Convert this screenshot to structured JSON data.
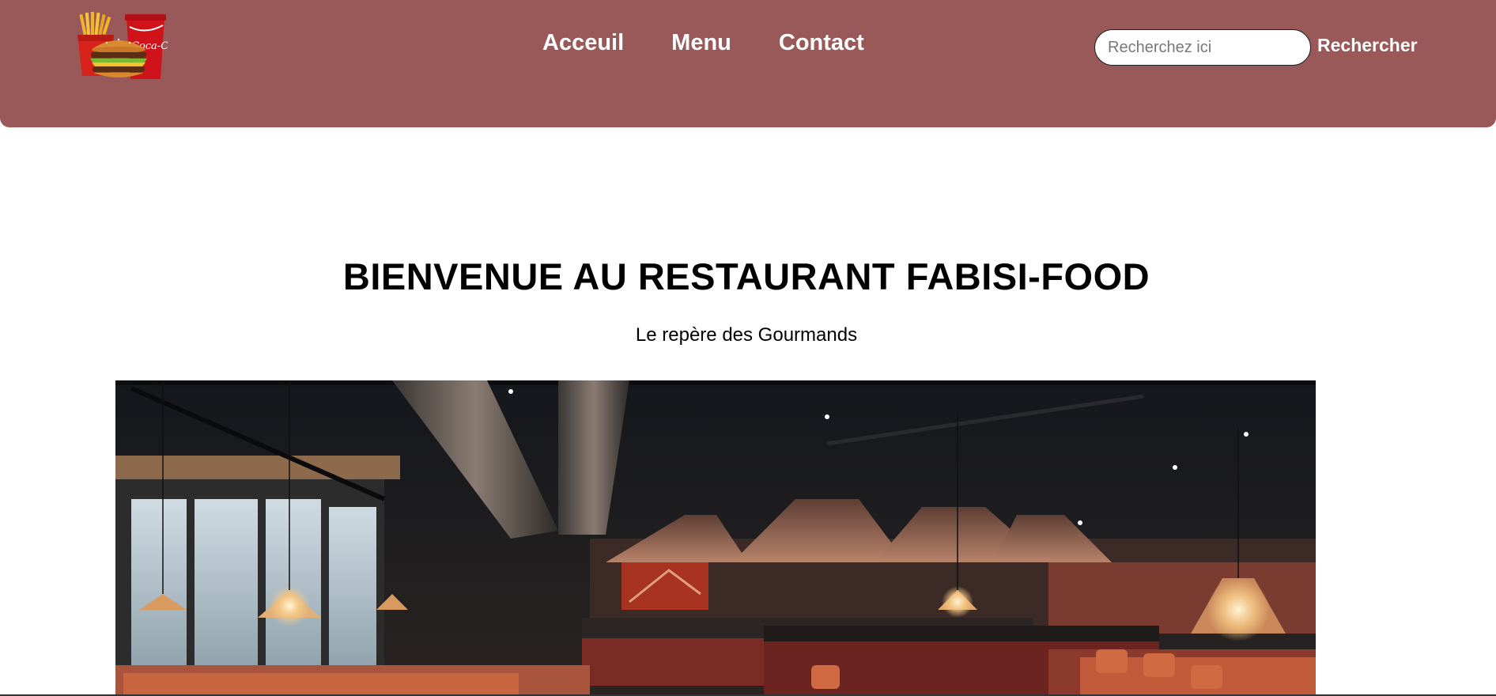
{
  "header": {
    "logo": {
      "icon": "burger-fries-cola-logo",
      "cup_text": "Coca-Cola"
    },
    "nav": [
      {
        "label": "Acceuil"
      },
      {
        "label": "Menu"
      },
      {
        "label": "Contact"
      }
    ],
    "search": {
      "placeholder": "Recherchez ici",
      "value": "",
      "button_label": "Rechercher"
    },
    "colors": {
      "background": "#995959",
      "text": "#ffffff"
    }
  },
  "hero": {
    "title": "BIENVENUE AU RESTAURANT FABISI-FOOD",
    "subtitle": "Le repère des Gourmands",
    "image": {
      "icon": "restaurant-interior-photo"
    }
  }
}
